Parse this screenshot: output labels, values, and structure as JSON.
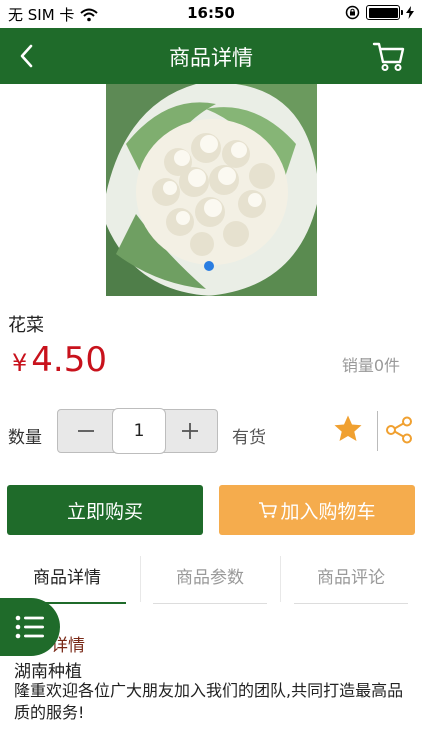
{
  "status": {
    "carrier": "无 SIM 卡",
    "time": "16:50",
    "battery_level": 1.0
  },
  "nav": {
    "title": "商品详情",
    "back_icon": "chevron-left-icon",
    "cart_icon": "cart-icon"
  },
  "product": {
    "name": "花菜",
    "currency": "¥",
    "price": "4.50",
    "sales": "销量0件",
    "image_alt": "cauliflower-photo",
    "carousel_pages": 1,
    "carousel_current": 1
  },
  "purchase": {
    "qty_label": "数量",
    "quantity": "1",
    "minus_icon": "minus-icon",
    "plus_icon": "plus-icon",
    "stock": "有货",
    "buy_label": "立即购买",
    "cart_label": "加入购物车"
  },
  "tabs": [
    {
      "label": "商品详情",
      "active": true
    },
    {
      "label": "商品参数",
      "active": false
    },
    {
      "label": "商品评论",
      "active": false
    }
  ],
  "detail": {
    "section_title": "详情",
    "heading": "湖南种植",
    "body": "隆重欢迎各位广大朋友加入我们的团队,共同打造最高品质的服务!"
  },
  "colors": {
    "primary": "#1f6b2a",
    "accent": "#f5ac4d",
    "price": "#c8121c",
    "star": "#f0a030"
  }
}
